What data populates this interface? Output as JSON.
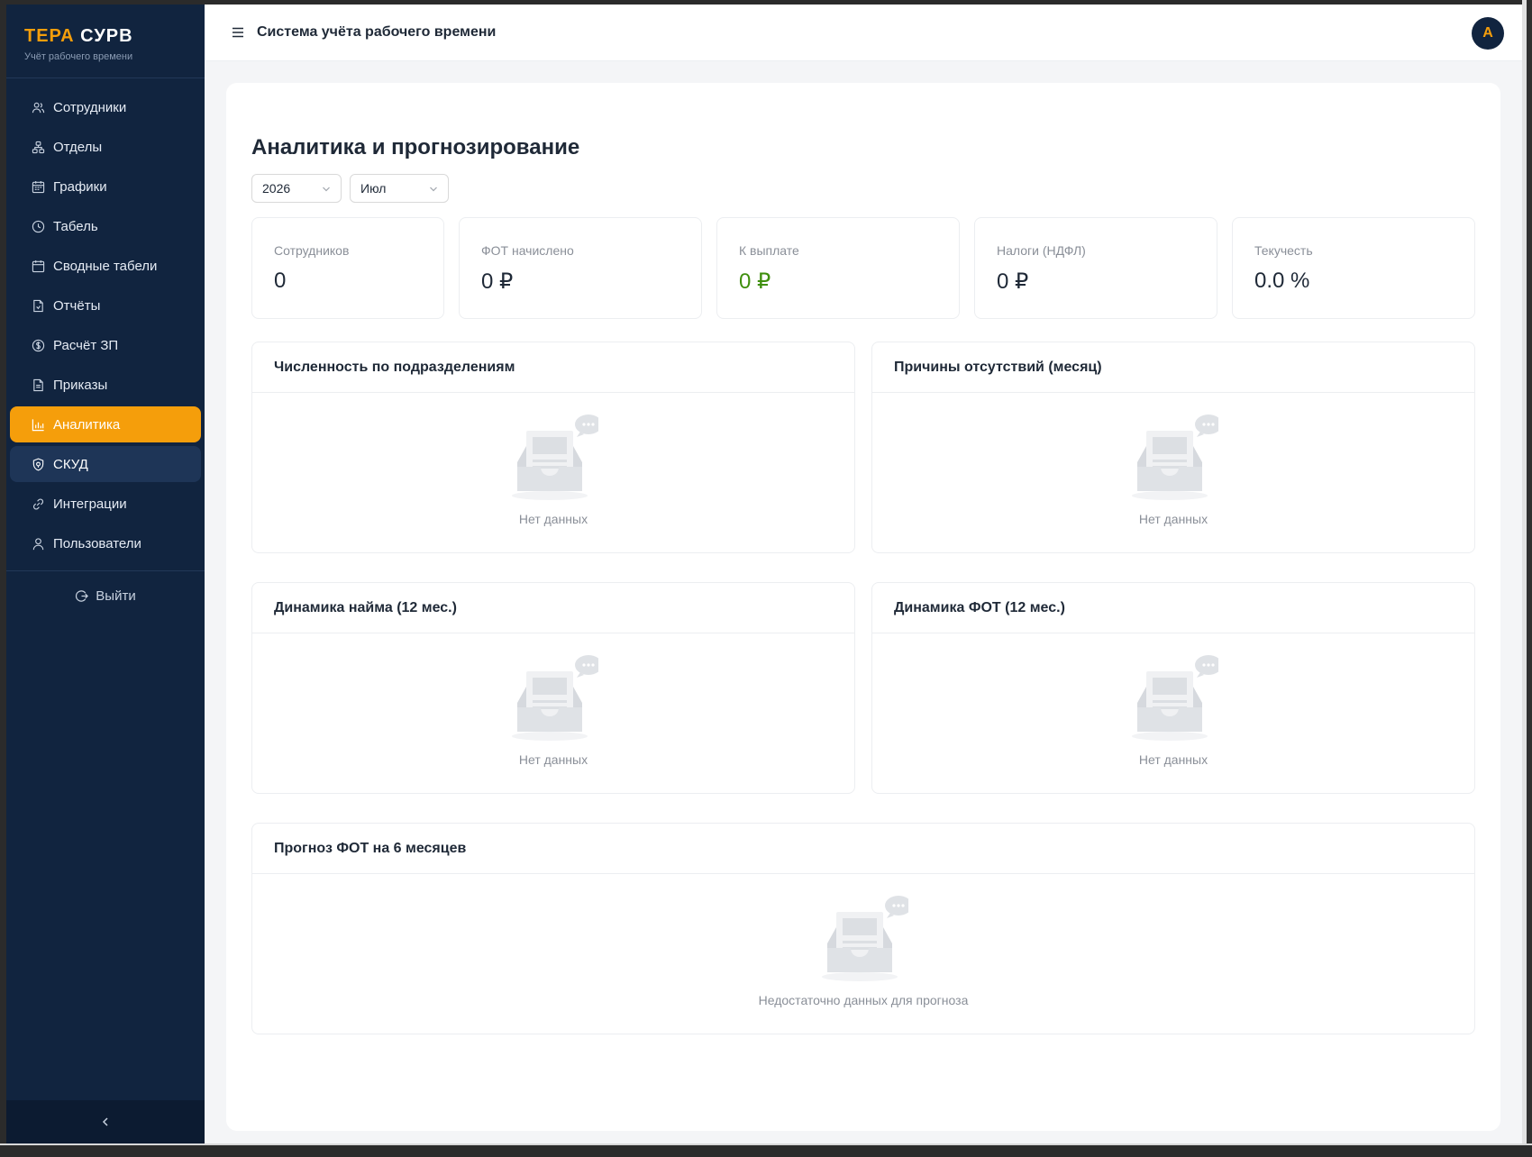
{
  "logo": {
    "part1": "ТЕРА",
    "part2": "СУРВ",
    "subtitle": "Учёт рабочего времени"
  },
  "sidebar": {
    "items": [
      {
        "label": "Сотрудники",
        "icon": "users-icon"
      },
      {
        "label": "Отделы",
        "icon": "org-icon"
      },
      {
        "label": "Графики",
        "icon": "schedule-icon"
      },
      {
        "label": "Табель",
        "icon": "clock-icon"
      },
      {
        "label": "Сводные табели",
        "icon": "calendar-icon"
      },
      {
        "label": "Отчёты",
        "icon": "report-icon"
      },
      {
        "label": "Расчёт ЗП",
        "icon": "dollar-icon"
      },
      {
        "label": "Приказы",
        "icon": "document-icon"
      },
      {
        "label": "Аналитика",
        "icon": "bar-chart-icon",
        "active": true
      },
      {
        "label": "СКУД",
        "icon": "shield-icon"
      },
      {
        "label": "Интеграции",
        "icon": "link-icon"
      },
      {
        "label": "Пользователи",
        "icon": "user-icon"
      }
    ],
    "logout_label": "Выйти",
    "active_color": "#f59e0b",
    "background": "#11243f"
  },
  "header": {
    "title": "Система учёта рабочего времени",
    "avatar_letter": "A"
  },
  "page": {
    "title": "Аналитика и прогнозирование",
    "year": "2026",
    "month": "Июл"
  },
  "stats": [
    {
      "label": "Сотрудников",
      "value": "0"
    },
    {
      "label": "ФОТ начислено",
      "value": "0 ₽"
    },
    {
      "label": "К выплате",
      "value": "0 ₽",
      "color": "#3f8f0e"
    },
    {
      "label": "Налоги (НДФЛ)",
      "value": "0 ₽"
    },
    {
      "label": "Текучесть",
      "value": "0.0 %"
    }
  ],
  "panels": {
    "headcount": {
      "title": "Численность по подразделениям",
      "empty": "Нет данных"
    },
    "absences": {
      "title": "Причины отсутствий (месяц)",
      "empty": "Нет данных"
    },
    "hiring": {
      "title": "Динамика найма (12 мес.)",
      "empty": "Нет данных"
    },
    "payroll": {
      "title": "Динамика ФОТ (12 мес.)",
      "empty": "Нет данных"
    },
    "forecast": {
      "title": "Прогноз ФОТ на 6 месяцев",
      "empty": "Недостаточно данных для прогноза"
    }
  }
}
